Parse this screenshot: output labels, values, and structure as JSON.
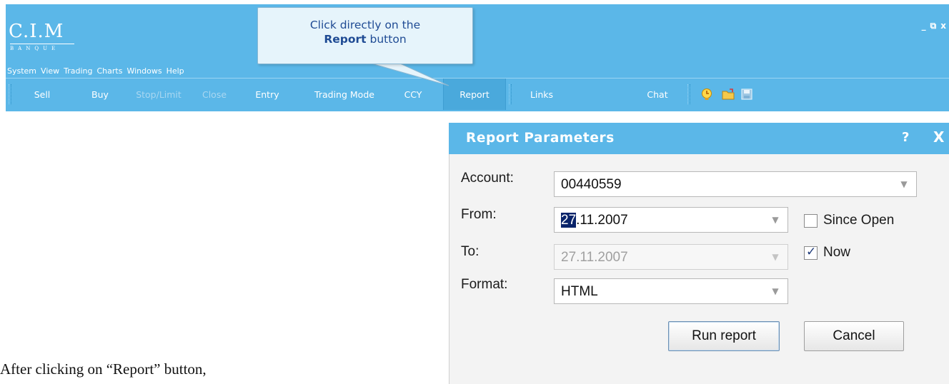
{
  "app": {
    "logo": {
      "main": "C.I.M",
      "sub": "BANQUE"
    },
    "window_controls": [
      "_",
      "⧉",
      "x"
    ],
    "menu": [
      "System",
      "View",
      "Trading",
      "Charts",
      "Windows",
      "Help"
    ],
    "toolbar": {
      "buttons": [
        {
          "label": "Sell",
          "enabled": true
        },
        {
          "label": "Buy",
          "enabled": true
        },
        {
          "label": "Stop/Limit",
          "enabled": false
        },
        {
          "label": "Close",
          "enabled": false
        },
        {
          "label": "Entry",
          "enabled": true
        },
        {
          "label": "Trading Mode",
          "enabled": true
        },
        {
          "label": "CCY",
          "enabled": true
        },
        {
          "label": "Report",
          "enabled": true,
          "selected": true
        },
        {
          "label": "Links",
          "enabled": true
        },
        {
          "label": "Chat",
          "enabled": true
        }
      ],
      "icons": [
        "bulb-clock-icon",
        "folder-icon",
        "save-icon"
      ]
    }
  },
  "callout": {
    "line1": "Click directly on the",
    "line2_strong": "Report",
    "line2_rest": " button"
  },
  "dialog": {
    "title": "Report Parameters",
    "help": "?",
    "close": "X",
    "fields": {
      "account": {
        "label": "Account:",
        "value": "00440559"
      },
      "from": {
        "label": "From:",
        "value_selected": "27",
        "value_rest": ".11.2007"
      },
      "to": {
        "label": "To:",
        "value": "27.11.2007",
        "disabled": true
      },
      "format": {
        "label": "Format:",
        "value": "HTML"
      }
    },
    "checkboxes": {
      "since_open": {
        "label": "Since Open",
        "checked": false
      },
      "now": {
        "label": "Now",
        "checked": true
      }
    },
    "buttons": {
      "run": "Run report",
      "cancel": "Cancel"
    }
  },
  "caption": "After clicking on “Report” button,",
  "colors": {
    "app_bar": "#5bb7e8",
    "callout_text": "#1f4b94",
    "selection": "#0a246a"
  }
}
